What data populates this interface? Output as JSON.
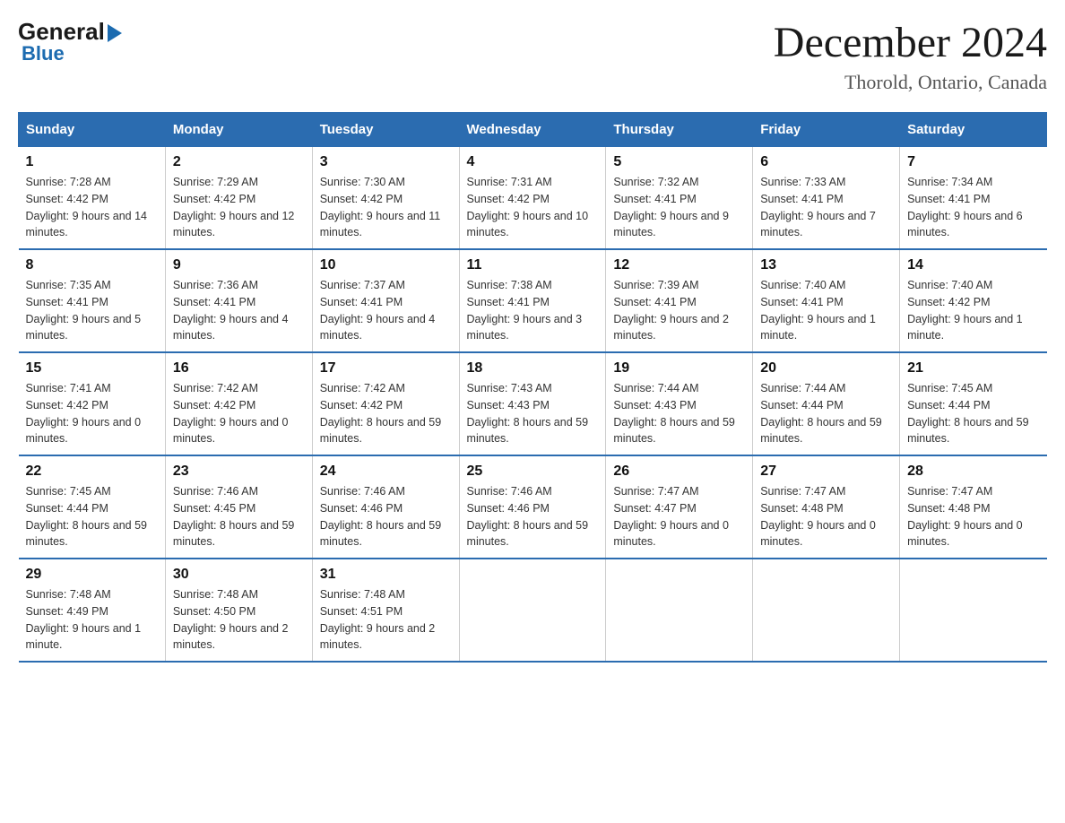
{
  "logo": {
    "general": "General",
    "blue": "Blue"
  },
  "title": "December 2024",
  "location": "Thorold, Ontario, Canada",
  "days_of_week": [
    "Sunday",
    "Monday",
    "Tuesday",
    "Wednesday",
    "Thursday",
    "Friday",
    "Saturday"
  ],
  "weeks": [
    [
      {
        "day": "1",
        "sunrise": "7:28 AM",
        "sunset": "4:42 PM",
        "daylight": "9 hours and 14 minutes."
      },
      {
        "day": "2",
        "sunrise": "7:29 AM",
        "sunset": "4:42 PM",
        "daylight": "9 hours and 12 minutes."
      },
      {
        "day": "3",
        "sunrise": "7:30 AM",
        "sunset": "4:42 PM",
        "daylight": "9 hours and 11 minutes."
      },
      {
        "day": "4",
        "sunrise": "7:31 AM",
        "sunset": "4:42 PM",
        "daylight": "9 hours and 10 minutes."
      },
      {
        "day": "5",
        "sunrise": "7:32 AM",
        "sunset": "4:41 PM",
        "daylight": "9 hours and 9 minutes."
      },
      {
        "day": "6",
        "sunrise": "7:33 AM",
        "sunset": "4:41 PM",
        "daylight": "9 hours and 7 minutes."
      },
      {
        "day": "7",
        "sunrise": "7:34 AM",
        "sunset": "4:41 PM",
        "daylight": "9 hours and 6 minutes."
      }
    ],
    [
      {
        "day": "8",
        "sunrise": "7:35 AM",
        "sunset": "4:41 PM",
        "daylight": "9 hours and 5 minutes."
      },
      {
        "day": "9",
        "sunrise": "7:36 AM",
        "sunset": "4:41 PM",
        "daylight": "9 hours and 4 minutes."
      },
      {
        "day": "10",
        "sunrise": "7:37 AM",
        "sunset": "4:41 PM",
        "daylight": "9 hours and 4 minutes."
      },
      {
        "day": "11",
        "sunrise": "7:38 AM",
        "sunset": "4:41 PM",
        "daylight": "9 hours and 3 minutes."
      },
      {
        "day": "12",
        "sunrise": "7:39 AM",
        "sunset": "4:41 PM",
        "daylight": "9 hours and 2 minutes."
      },
      {
        "day": "13",
        "sunrise": "7:40 AM",
        "sunset": "4:41 PM",
        "daylight": "9 hours and 1 minute."
      },
      {
        "day": "14",
        "sunrise": "7:40 AM",
        "sunset": "4:42 PM",
        "daylight": "9 hours and 1 minute."
      }
    ],
    [
      {
        "day": "15",
        "sunrise": "7:41 AM",
        "sunset": "4:42 PM",
        "daylight": "9 hours and 0 minutes."
      },
      {
        "day": "16",
        "sunrise": "7:42 AM",
        "sunset": "4:42 PM",
        "daylight": "9 hours and 0 minutes."
      },
      {
        "day": "17",
        "sunrise": "7:42 AM",
        "sunset": "4:42 PM",
        "daylight": "8 hours and 59 minutes."
      },
      {
        "day": "18",
        "sunrise": "7:43 AM",
        "sunset": "4:43 PM",
        "daylight": "8 hours and 59 minutes."
      },
      {
        "day": "19",
        "sunrise": "7:44 AM",
        "sunset": "4:43 PM",
        "daylight": "8 hours and 59 minutes."
      },
      {
        "day": "20",
        "sunrise": "7:44 AM",
        "sunset": "4:44 PM",
        "daylight": "8 hours and 59 minutes."
      },
      {
        "day": "21",
        "sunrise": "7:45 AM",
        "sunset": "4:44 PM",
        "daylight": "8 hours and 59 minutes."
      }
    ],
    [
      {
        "day": "22",
        "sunrise": "7:45 AM",
        "sunset": "4:44 PM",
        "daylight": "8 hours and 59 minutes."
      },
      {
        "day": "23",
        "sunrise": "7:46 AM",
        "sunset": "4:45 PM",
        "daylight": "8 hours and 59 minutes."
      },
      {
        "day": "24",
        "sunrise": "7:46 AM",
        "sunset": "4:46 PM",
        "daylight": "8 hours and 59 minutes."
      },
      {
        "day": "25",
        "sunrise": "7:46 AM",
        "sunset": "4:46 PM",
        "daylight": "8 hours and 59 minutes."
      },
      {
        "day": "26",
        "sunrise": "7:47 AM",
        "sunset": "4:47 PM",
        "daylight": "9 hours and 0 minutes."
      },
      {
        "day": "27",
        "sunrise": "7:47 AM",
        "sunset": "4:48 PM",
        "daylight": "9 hours and 0 minutes."
      },
      {
        "day": "28",
        "sunrise": "7:47 AM",
        "sunset": "4:48 PM",
        "daylight": "9 hours and 0 minutes."
      }
    ],
    [
      {
        "day": "29",
        "sunrise": "7:48 AM",
        "sunset": "4:49 PM",
        "daylight": "9 hours and 1 minute."
      },
      {
        "day": "30",
        "sunrise": "7:48 AM",
        "sunset": "4:50 PM",
        "daylight": "9 hours and 2 minutes."
      },
      {
        "day": "31",
        "sunrise": "7:48 AM",
        "sunset": "4:51 PM",
        "daylight": "9 hours and 2 minutes."
      },
      null,
      null,
      null,
      null
    ]
  ]
}
